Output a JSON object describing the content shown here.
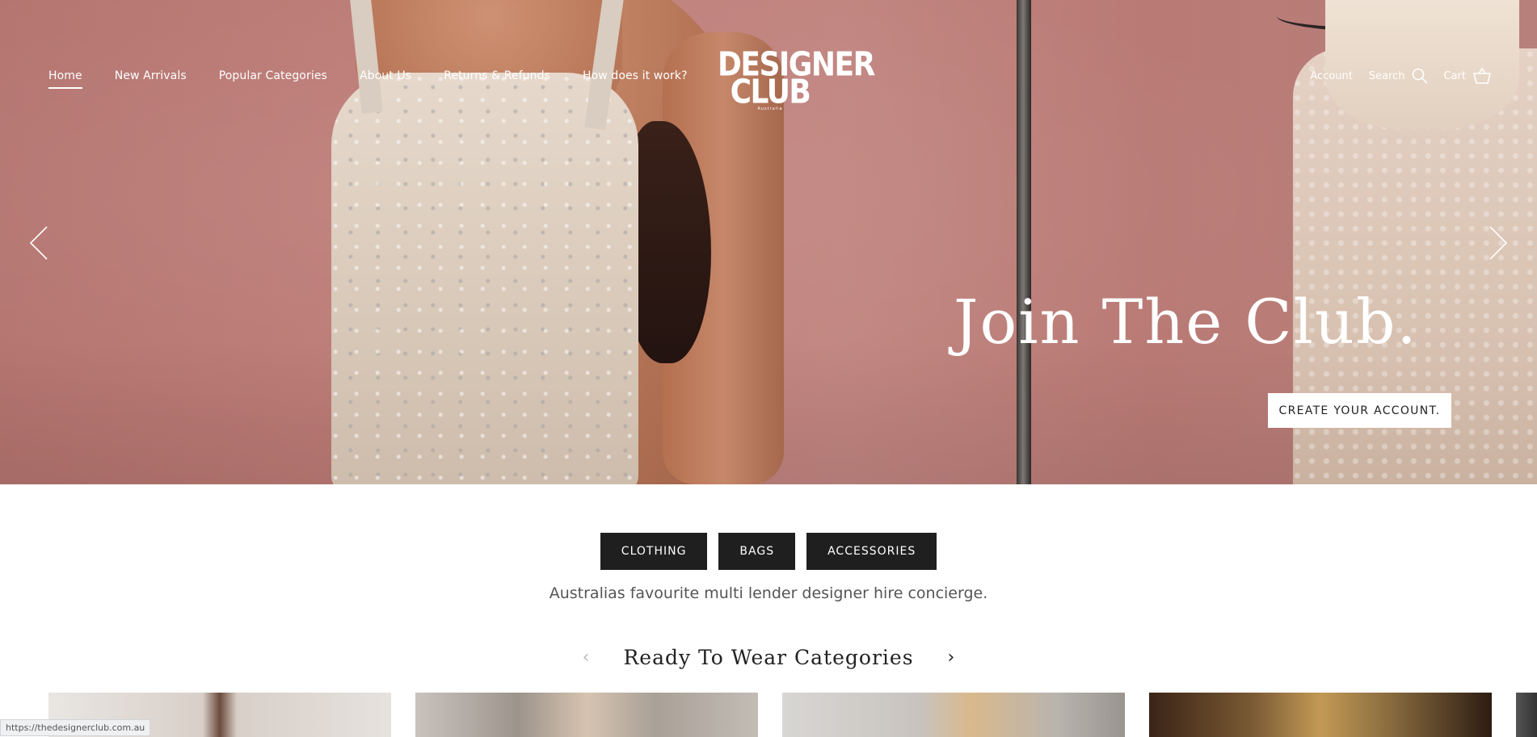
{
  "nav": {
    "items": [
      {
        "label": "Home",
        "active": true
      },
      {
        "label": "New Arrivals"
      },
      {
        "label": "Popular Categories"
      },
      {
        "label": "About Us"
      },
      {
        "label": "Returns & Refunds"
      },
      {
        "label": "How does it work?"
      }
    ]
  },
  "logo": {
    "line1": "DESIGNER",
    "line2": "CLUB",
    "line3": "Australia"
  },
  "utils": {
    "account": "Account",
    "search": "Search",
    "cart": "Cart"
  },
  "hero": {
    "title": "Join The Club.",
    "button": "CREATE YOUR ACCOUNT.",
    "prev_icon": "chevron-left-icon",
    "next_icon": "chevron-right-icon"
  },
  "categories": [
    "CLOTHING",
    "BAGS",
    "ACCESSORIES"
  ],
  "tagline": "Australias favourite multi lender designer hire concierge.",
  "section": {
    "title": "Ready To Wear Categories",
    "prev": "‹",
    "next": "›"
  },
  "status_url": "https://thedesignerclub.com.au",
  "colors": {
    "hero_bg": "#bf7d78",
    "button_dark": "#1f1f1f"
  }
}
